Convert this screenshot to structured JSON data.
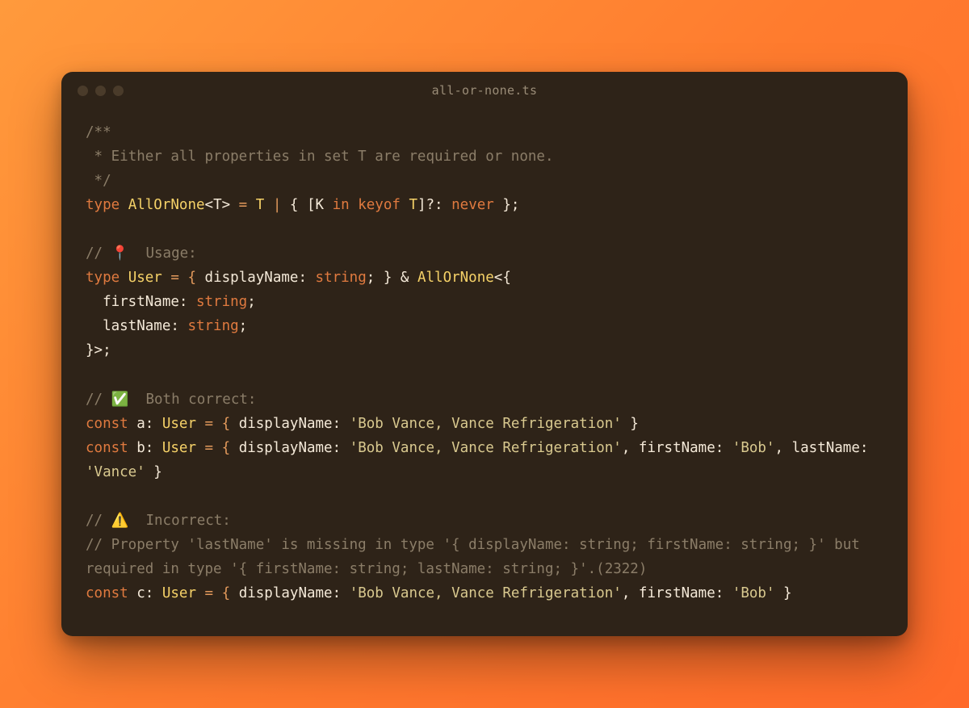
{
  "window": {
    "title": "all-or-none.ts"
  },
  "code": {
    "l1": "/**",
    "l2": " * Either all properties in set T are required or none.",
    "l3": " */",
    "l4": {
      "kw1": "type",
      "name": "AllOrNone",
      "gen": "<T>",
      "eq": " = ",
      "t": "T",
      "pipe": " | ",
      "brace_l": "{ [K ",
      "in": "in",
      "keyof": " keyof ",
      "t2": "T",
      "rest": "]?: ",
      "never": "never",
      "close": " };"
    },
    "l6_pre": "// ",
    "l6_emoji": "📍",
    "l6_txt": "  Usage:",
    "l7": {
      "kw": "type",
      "name": "User",
      "eq": " = { ",
      "prop": "displayName",
      "col": ": ",
      "str": "string",
      "semi": "; } & ",
      "aot": "AllOrNone",
      "open": "<{"
    },
    "l8": {
      "indent": "  ",
      "prop": "firstName",
      "col": ": ",
      "str": "string",
      "semi": ";"
    },
    "l9": {
      "indent": "  ",
      "prop": "lastName",
      "col": ": ",
      "str": "string",
      "semi": ";"
    },
    "l10": "}>;",
    "l12_pre": "// ",
    "l12_emoji": "✅",
    "l12_txt": "  Both correct:",
    "l13": {
      "kw": "const",
      "name": "a",
      "col": ": ",
      "type": "User",
      "eq": " = { ",
      "prop": "displayName",
      "pcol": ": ",
      "val": "'Bob Vance, Vance Refrigeration'",
      "close": " }"
    },
    "l14": {
      "kw": "const",
      "name": "b",
      "col": ": ",
      "type": "User",
      "eq": " = { ",
      "p1": "displayName",
      "c1": ": ",
      "v1": "'Bob Vance, Vance Refrigeration'",
      "s1": ", ",
      "p2": "firstName",
      "c2": ": ",
      "v2": "'Bob'",
      "s2": ", ",
      "p3": "lastName",
      "c3": ": ",
      "v3": "'Vance'",
      "close": " }"
    },
    "l16_pre": "// ",
    "l16_emoji": "⚠️",
    "l16_txt": "  Incorrect:",
    "l17": "// Property 'lastName' is missing in type '{ displayName: string; firstName: string; }' but required in type '{ firstName: string; lastName: string; }'.(2322)",
    "l18": {
      "kw": "const",
      "name": "c",
      "col": ": ",
      "type": "User",
      "eq": " = { ",
      "p1": "displayName",
      "c1": ": ",
      "v1": "'Bob Vance, Vance Refrigeration'",
      "s1": ", ",
      "p2": "firstName",
      "c2": ": ",
      "v2": "'Bob'",
      "close": " }"
    }
  }
}
